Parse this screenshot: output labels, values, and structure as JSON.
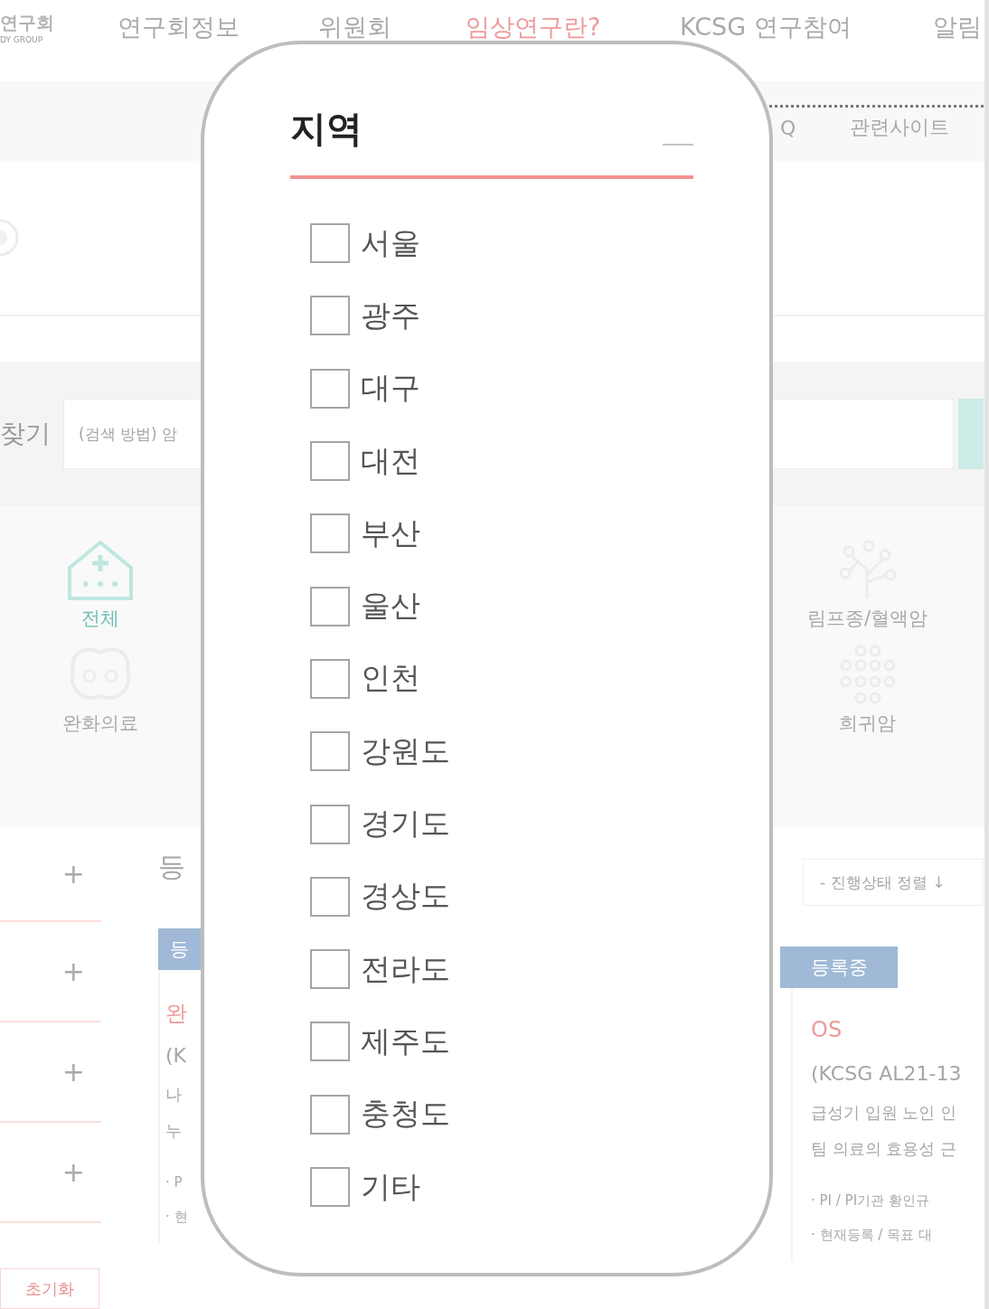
{
  "nav": {
    "logo": "연구회",
    "logo_sub": "DY GROUP",
    "items": [
      {
        "label": "연구회정보",
        "selected": false
      },
      {
        "label": "위원회",
        "selected": false
      },
      {
        "label": "임상연구란?",
        "selected": true
      },
      {
        "label": "KCSG 연구참여",
        "selected": false
      },
      {
        "label": "알림",
        "selected": false
      }
    ]
  },
  "subnav": {
    "items": [
      "Q",
      "관련사이트"
    ]
  },
  "search": {
    "label": "찾기",
    "placeholder": "(검색 방법) 암"
  },
  "categories": [
    {
      "label": "전체",
      "selected": true
    },
    {
      "label": "완화의료",
      "selected": false
    },
    {
      "label": "림프종/혈액암",
      "selected": false
    },
    {
      "label": "희귀암",
      "selected": false
    }
  ],
  "filters": {
    "rows": [
      "+",
      "+",
      "+",
      "+"
    ],
    "reset": "초기화"
  },
  "results": {
    "heading": "등",
    "sort": "- 진행상태 정렬 ↓",
    "cards": [
      {
        "badge": "등",
        "title": "완",
        "code": "(K",
        "desc": [
          "나",
          "누"
        ],
        "info": [
          "· P",
          "· 현"
        ]
      },
      {
        "badge": "등록중",
        "title": "OS",
        "code": "(KCSG AL21-13",
        "desc": [
          "급성기 입원 노인 인",
          "팀 의료의 효용성 근"
        ],
        "info": [
          "· PI / PI기관  황인규",
          "· 현재등록 / 목표 대"
        ]
      }
    ]
  },
  "panel": {
    "title": "지역",
    "options": [
      {
        "label": "서울",
        "checked": false
      },
      {
        "label": "광주",
        "checked": false
      },
      {
        "label": "대구",
        "checked": false
      },
      {
        "label": "대전",
        "checked": false
      },
      {
        "label": "부산",
        "checked": false
      },
      {
        "label": "울산",
        "checked": false
      },
      {
        "label": "인천",
        "checked": false
      },
      {
        "label": "강원도",
        "checked": false
      },
      {
        "label": "경기도",
        "checked": false
      },
      {
        "label": "경상도",
        "checked": false
      },
      {
        "label": "전라도",
        "checked": false
      },
      {
        "label": "제주도",
        "checked": false
      },
      {
        "label": "충청도",
        "checked": false
      },
      {
        "label": "기타",
        "checked": false
      }
    ]
  }
}
